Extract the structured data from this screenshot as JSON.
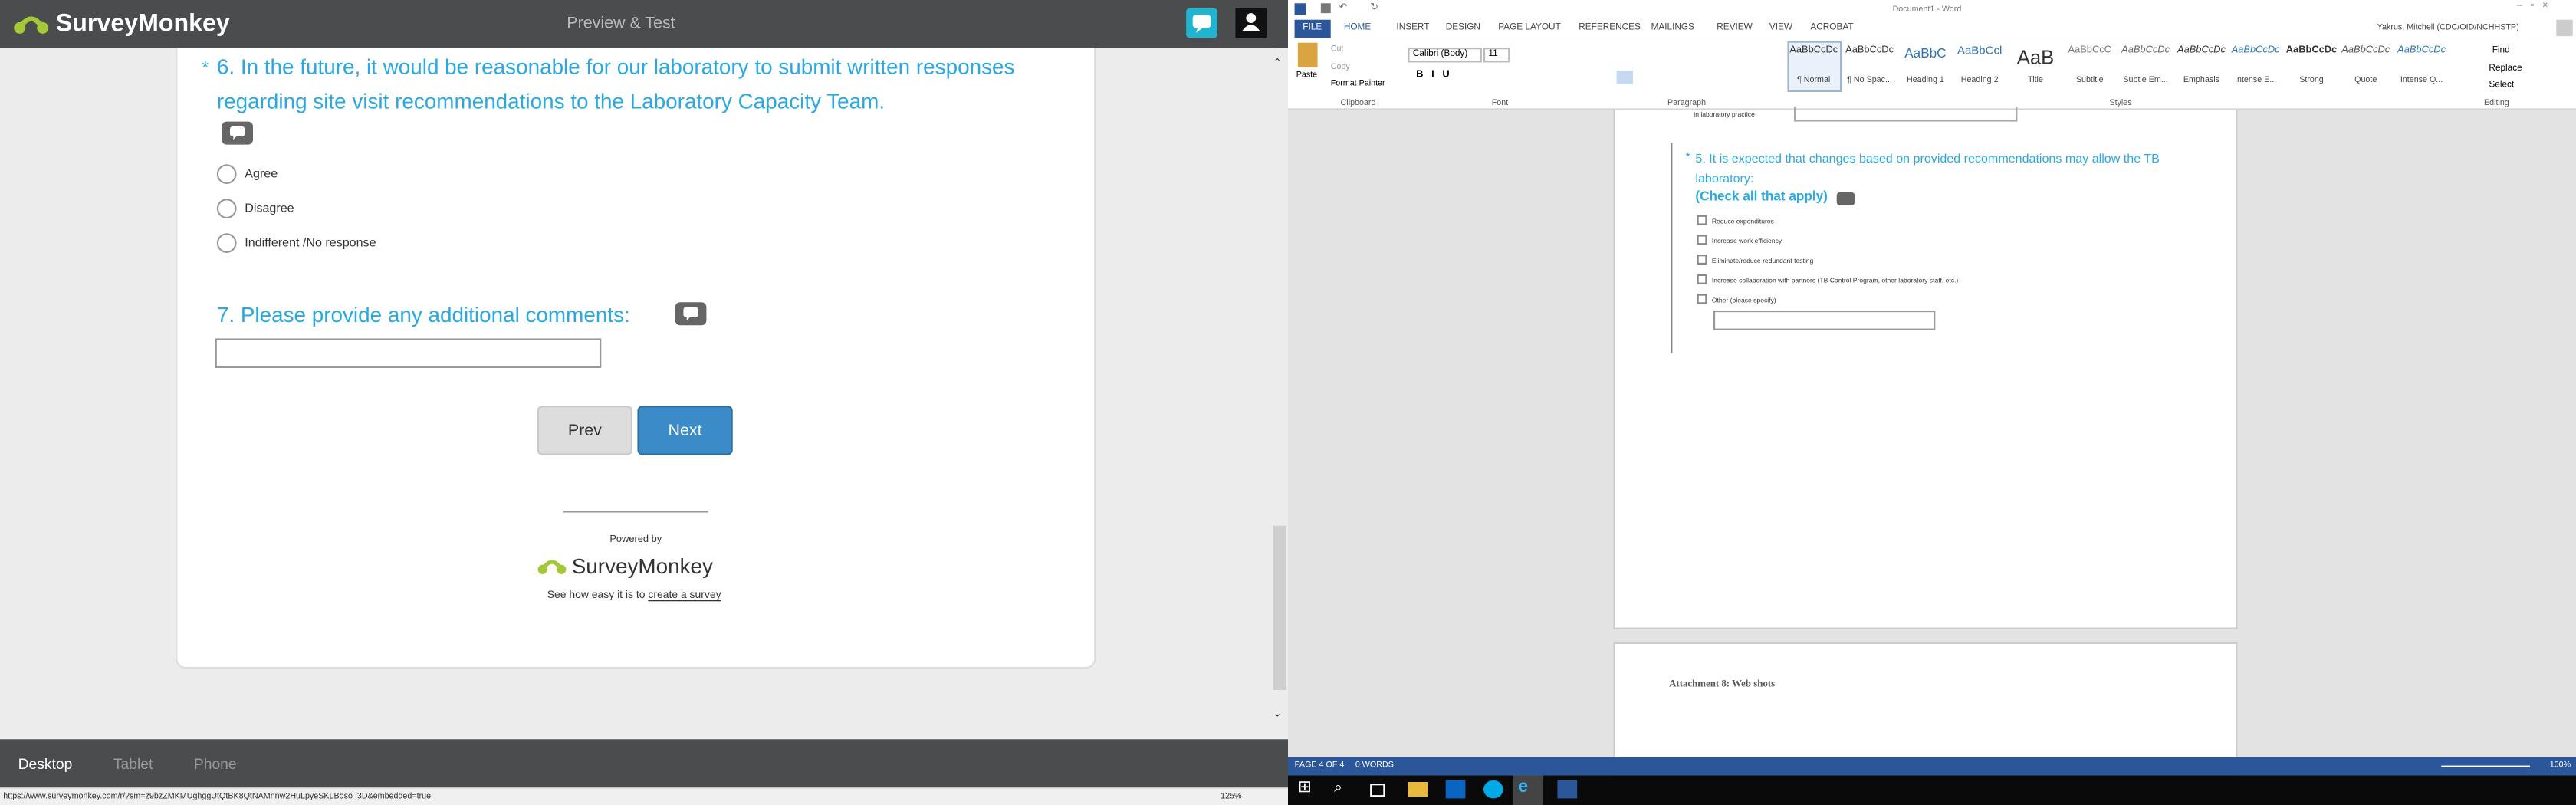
{
  "surveymonkey": {
    "brand": "SurveyMonkey",
    "header_title": "Preview & Test",
    "q6": {
      "number_mark": "*",
      "text": "6. In the future, it would be reasonable for our laboratory to submit written responses regarding site visit recommendations to the Laboratory Capacity Team.",
      "options": [
        "Agree",
        "Disagree",
        "Indifferent /No response"
      ]
    },
    "q7": {
      "text": "7. Please provide any additional comments:"
    },
    "prev_label": "Prev",
    "next_label": "Next",
    "powered_by": "Powered by",
    "see_text": "See how easy it is to",
    "create_link": "create a survey",
    "devices": [
      "Desktop",
      "Tablet",
      "Phone"
    ],
    "status_url": "https://www.surveymonkey.com/r/?sm=z9bzZMKMUghggUtQtBK8QtNAMnnw2HuLpyeSKLBoso_3D&embedded=true",
    "zoom": "125%"
  },
  "word": {
    "title": "Document1 - Word",
    "user": "Yakrus, Mitchell (CDC/OID/NCHHSTP)",
    "tabs": [
      "FILE",
      "HOME",
      "INSERT",
      "DESIGN",
      "PAGE LAYOUT",
      "REFERENCES",
      "MAILINGS",
      "REVIEW",
      "VIEW",
      "ACROBAT"
    ],
    "clipboard": {
      "paste": "Paste",
      "cut": "Cut",
      "copy": "Copy",
      "format_painter": "Format Painter",
      "label": "Clipboard"
    },
    "font": {
      "name": "Calibri (Body)",
      "size": "11",
      "label": "Font"
    },
    "paragraph_label": "Paragraph",
    "styles_label": "Styles",
    "editing": {
      "find": "Find",
      "replace": "Replace",
      "select": "Select",
      "label": "Editing"
    },
    "styles": [
      {
        "preview": "AaBbCcDc",
        "name": "¶ Normal"
      },
      {
        "preview": "AaBbCcDc",
        "name": "¶ No Spac..."
      },
      {
        "preview": "AaBbC",
        "name": "Heading 1"
      },
      {
        "preview": "AaBbCcl",
        "name": "Heading 2"
      },
      {
        "preview": "AaB",
        "name": "Title"
      },
      {
        "preview": "AaBbCcC",
        "name": "Subtitle"
      },
      {
        "preview": "AaBbCcDc",
        "name": "Subtle Em..."
      },
      {
        "preview": "AaBbCcDc",
        "name": "Emphasis"
      },
      {
        "preview": "AaBbCcDc",
        "name": "Intense E..."
      },
      {
        "preview": "AaBbCcDc",
        "name": "Strong"
      },
      {
        "preview": "AaBbCcDc",
        "name": "Quote"
      },
      {
        "preview": "AaBbCcDc",
        "name": "Intense Q..."
      }
    ],
    "doc": {
      "prev_line": "in laboratory practice",
      "q5_star": "*",
      "q5_text": "5. It is expected that changes based on provided recommendations may allow the TB laboratory:",
      "q5_sub": "(Check all that apply)",
      "checkboxes": [
        "Reduce expenditures",
        "Increase work efficiency",
        "Eliminate/reduce redundant testing",
        "Increase collaboration with partners (TB Control Program, other laboratory staff, etc.)",
        "Other (please specify)"
      ],
      "attachment": "Attachment 8: Web shots"
    },
    "status": {
      "page": "PAGE 4 OF 4",
      "words": "0 WORDS",
      "zoom": "100%"
    }
  }
}
